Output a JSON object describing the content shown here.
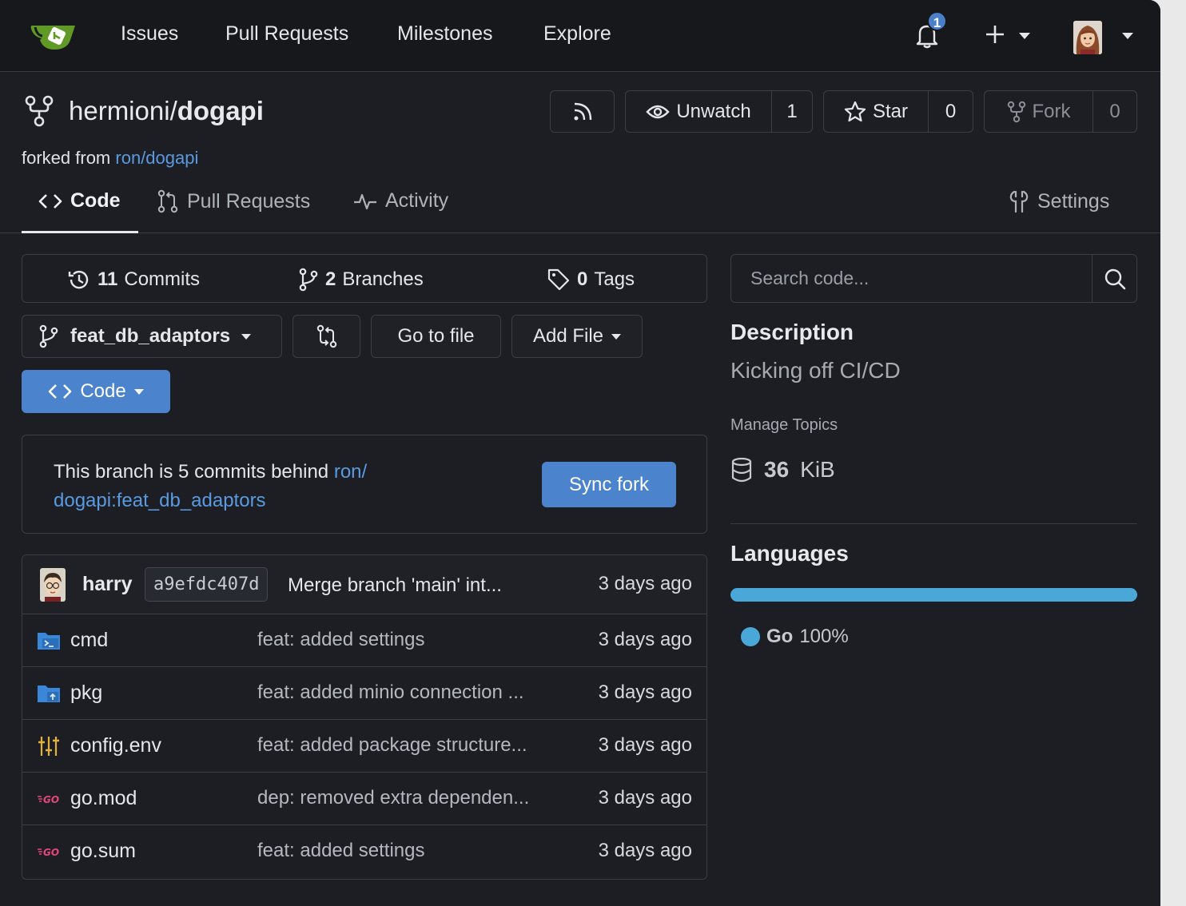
{
  "nav": {
    "items": [
      "Issues",
      "Pull Requests",
      "Milestones",
      "Explore"
    ],
    "notification_count": "1"
  },
  "repo": {
    "owner": "hermioni",
    "separator": "/",
    "name": "dogapi",
    "forked_prefix": "forked from",
    "forked_link": "ron/dogapi",
    "watch_label": "Unwatch",
    "watch_count": "1",
    "star_label": "Star",
    "star_count": "0",
    "fork_label": "Fork",
    "fork_count": "0"
  },
  "tabs": [
    {
      "label": "Code",
      "active": true
    },
    {
      "label": "Pull Requests",
      "active": false
    },
    {
      "label": "Activity",
      "active": false
    },
    {
      "label": "Settings",
      "active": false
    }
  ],
  "stats": {
    "commits_count": "11",
    "commits_label": "Commits",
    "branches_count": "2",
    "branches_label": "Branches",
    "tags_count": "0",
    "tags_label": "Tags"
  },
  "toolbar": {
    "branch": "feat_db_adaptors",
    "go_to_file": "Go to file",
    "add_file": "Add File",
    "code": "Code"
  },
  "behind": {
    "text": "This branch is 5 commits behind",
    "link": "ron/ dogapi:feat_db_adaptors",
    "sync_button": "Sync fork"
  },
  "latest_commit": {
    "author": "harry",
    "sha": "a9efdc407d",
    "message": "Merge branch 'main' int...",
    "time": "3 days ago"
  },
  "files": [
    {
      "name": "cmd",
      "icon": "folder-terminal-icon",
      "message": "feat: added settings",
      "time": "3 days ago"
    },
    {
      "name": "pkg",
      "icon": "folder-package-icon",
      "message": "feat: added minio connection ...",
      "time": "3 days ago"
    },
    {
      "name": "config.env",
      "icon": "tune-icon",
      "message": "feat: added package structure...",
      "time": "3 days ago"
    },
    {
      "name": "go.mod",
      "icon": "go-icon",
      "message": "dep: removed extra dependen...",
      "time": "3 days ago"
    },
    {
      "name": "go.sum",
      "icon": "go-icon",
      "message": "feat: added settings",
      "time": "3 days ago"
    }
  ],
  "sidebar": {
    "search_placeholder": "Search code...",
    "description_heading": "Description",
    "description": "Kicking off CI/CD",
    "manage_topics": "Manage Topics",
    "size_value": "36",
    "size_unit": "KiB",
    "languages_heading": "Languages",
    "language_name": "Go",
    "language_percent": "100%",
    "language_color": "#4aa8d8"
  },
  "colors": {
    "background": "#1c1e23",
    "accent": "#4b83cc",
    "link": "#5a9ae0"
  }
}
